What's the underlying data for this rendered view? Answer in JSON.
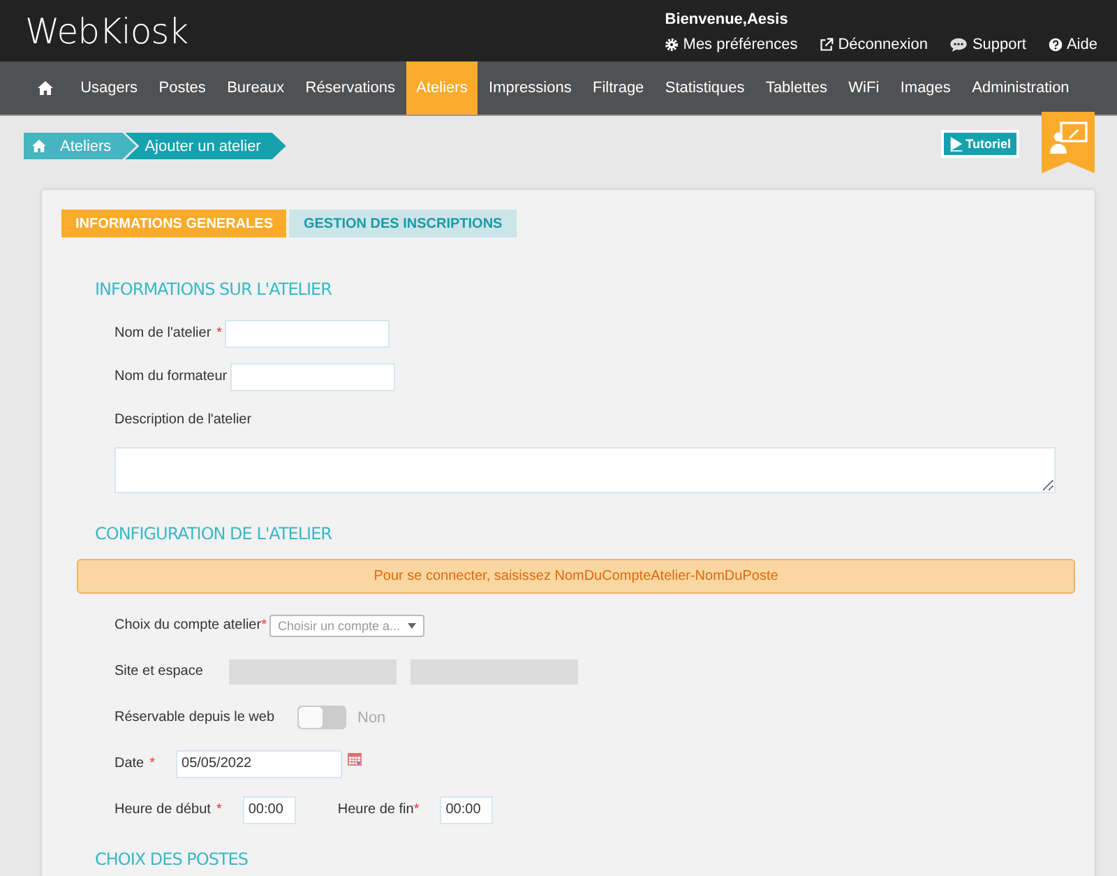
{
  "header": {
    "logo": "WebKiosk",
    "welcome": "Bienvenue,Aesis",
    "links": [
      {
        "kind": "settings",
        "label": "Mes préférences"
      },
      {
        "kind": "logout",
        "label": "Déconnexion"
      },
      {
        "kind": "support",
        "label": "Support"
      },
      {
        "kind": "help",
        "label": "Aide"
      }
    ]
  },
  "nav": [
    {
      "label": "Usagers",
      "selected": false
    },
    {
      "label": "Postes",
      "selected": false
    },
    {
      "label": "Bureaux",
      "selected": false
    },
    {
      "label": "Réservations",
      "selected": false
    },
    {
      "label": "Ateliers",
      "selected": true
    },
    {
      "label": "Impressions",
      "selected": false
    },
    {
      "label": "Filtrage",
      "selected": false
    },
    {
      "label": "Statistiques",
      "selected": false
    },
    {
      "label": "Tablettes",
      "selected": false
    },
    {
      "label": "WiFi",
      "selected": false
    },
    {
      "label": "Images",
      "selected": false
    },
    {
      "label": "Administration",
      "selected": false
    }
  ],
  "breadcrumb": [
    "Ateliers",
    "Ajouter un atelier"
  ],
  "tutorial_button": "Tutoriel",
  "tabs": [
    {
      "label": "INFORMATIONS GENERALES",
      "selected": true
    },
    {
      "label": "GESTION DES INSCRIPTIONS",
      "selected": false
    }
  ],
  "sections": [
    {
      "title": "INFORMATIONS SUR L'ATELIER",
      "rows": [
        {
          "kind": "text",
          "label": "Nom de l'atelier",
          "mark": "*"
        },
        {
          "kind": "text",
          "label": "Nom du formateur"
        },
        {
          "kind": "textarea",
          "label": "Description de l'atelier"
        }
      ]
    },
    {
      "title": "CONFIGURATION DE L'ATELIER",
      "rows": [
        {
          "kind": "alert",
          "text": "Pour se connecter, saisissez NomDuCompteAtelier-NomDuPoste"
        },
        {
          "kind": "select",
          "label": "Choix du compte atelier",
          "mark": "*",
          "placeholder": "Choisir un compte a..."
        },
        {
          "kind": "readonly_pair",
          "label": "Site et espace"
        },
        {
          "kind": "toggle",
          "label": "Réservable depuis le web",
          "on": false,
          "state_text": "Non"
        },
        {
          "kind": "date",
          "label": "Date",
          "mark": "*",
          "value": "05/05/2022"
        },
        {
          "kind": "time_pair",
          "label": "Heure de début",
          "mark": "*",
          "value": "00:00",
          "label2": "Heure de fin",
          "mark2": "*",
          "value2": "00:00"
        }
      ]
    },
    {
      "title": "CHOIX DES POSTES"
    }
  ]
}
